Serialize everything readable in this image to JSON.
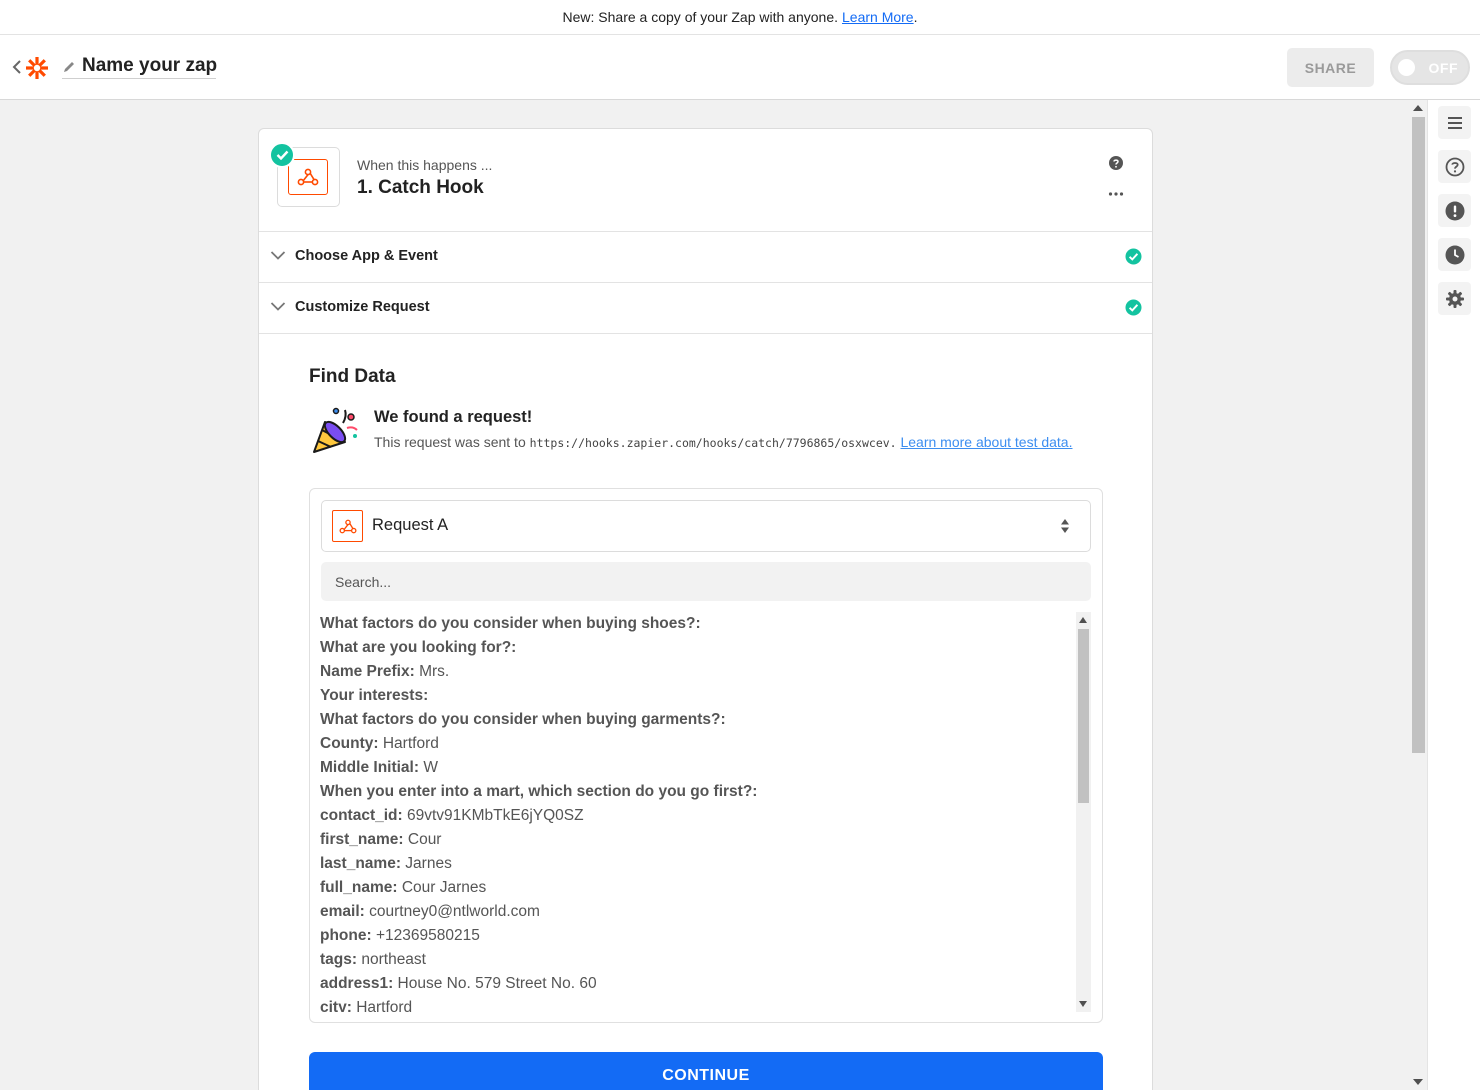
{
  "banner": {
    "text": "New: Share a copy of your Zap with anyone.",
    "link": "Learn More",
    "trailing": "."
  },
  "header": {
    "zap_name": "Name your zap",
    "share_label": "SHARE",
    "toggle_label": "OFF",
    "toggle_state": "off"
  },
  "step": {
    "when_label": "When this happens ...",
    "title": "1. Catch Hook",
    "status": "complete"
  },
  "sections": [
    {
      "label": "Choose App & Event",
      "status": "complete"
    },
    {
      "label": "Customize Request",
      "status": "complete"
    }
  ],
  "find_data": {
    "heading": "Find Data",
    "found_title": "We found a request!",
    "found_prefix": "This request was sent to",
    "url": "https://hooks.zapier.com/hooks/catch/7796865/osxwcev.",
    "learn_more": "Learn more about test data."
  },
  "request_select": {
    "value": "Request A"
  },
  "search": {
    "placeholder": "Search..."
  },
  "fields": [
    {
      "key": "What factors do you consider when buying shoes?:",
      "value": ""
    },
    {
      "key": "What are you looking for?:",
      "value": ""
    },
    {
      "key": "Name Prefix:",
      "value": "Mrs."
    },
    {
      "key": "Your interests:",
      "value": ""
    },
    {
      "key": "What factors do you consider when buying garments?:",
      "value": ""
    },
    {
      "key": "County:",
      "value": "Hartford"
    },
    {
      "key": "Middle Initial:",
      "value": "W"
    },
    {
      "key": "When you enter into a mart, which section do you go first?:",
      "value": ""
    },
    {
      "key": "contact_id:",
      "value": "69vtv91KMbTkE6jYQ0SZ"
    },
    {
      "key": "first_name:",
      "value": "Cour"
    },
    {
      "key": "last_name:",
      "value": "Jarnes"
    },
    {
      "key": "full_name:",
      "value": "Cour Jarnes"
    },
    {
      "key": "email:",
      "value": "courtney0@ntlworld.com"
    },
    {
      "key": "phone:",
      "value": "+12369580215"
    },
    {
      "key": "tags:",
      "value": "northeast"
    },
    {
      "key": "address1:",
      "value": "House No. 579 Street No. 60"
    },
    {
      "key": "city:",
      "value": "Hartford"
    }
  ],
  "continue_label": "CONTINUE",
  "colors": {
    "accent": "#136bf5",
    "success": "#13c3a0",
    "brand": "#ff4a00"
  }
}
